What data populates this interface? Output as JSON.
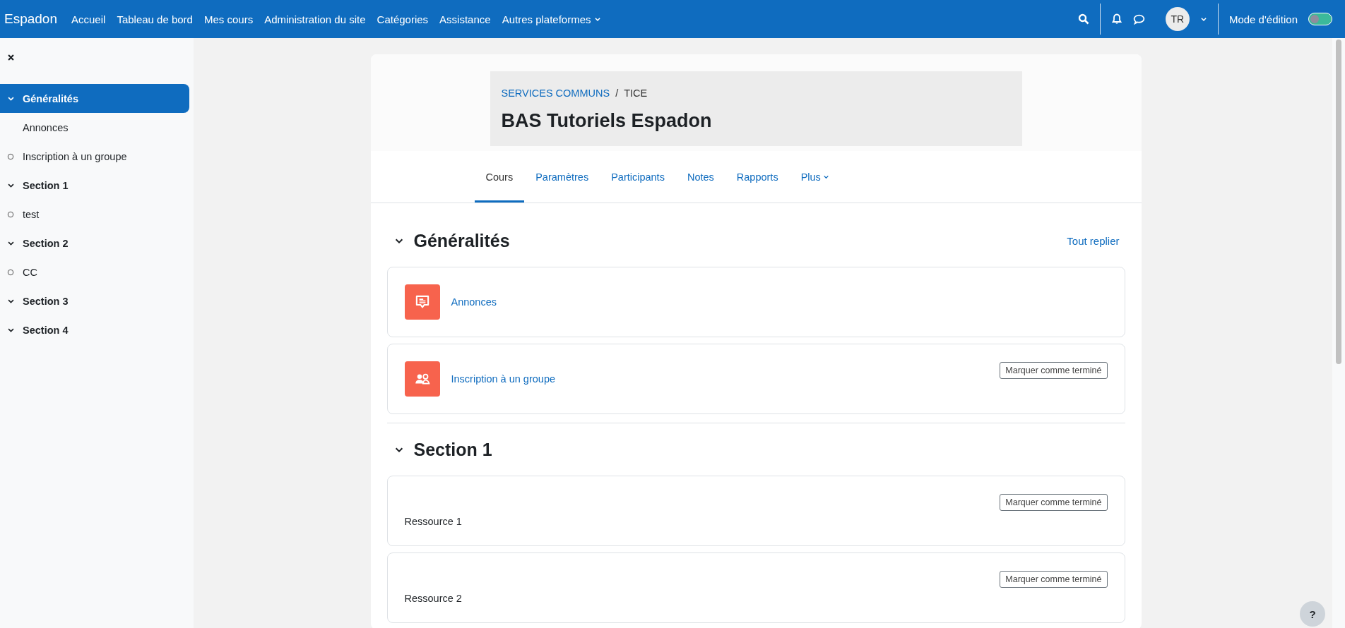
{
  "navbar": {
    "brand": "Espadon",
    "links": [
      {
        "label": "Accueil",
        "dropdown": false
      },
      {
        "label": "Tableau de bord",
        "dropdown": false
      },
      {
        "label": "Mes cours",
        "dropdown": false
      },
      {
        "label": "Administration du site",
        "dropdown": false
      },
      {
        "label": "Catégories",
        "dropdown": false
      },
      {
        "label": "Assistance",
        "dropdown": false
      },
      {
        "label": "Autres plateformes",
        "dropdown": true
      }
    ],
    "avatar": "TR",
    "edit_mode": {
      "label": "Mode d'édition",
      "on": false
    }
  },
  "sidebar": {
    "items": [
      {
        "label": "Généralités",
        "kind": "section",
        "selected": true,
        "expanded": true,
        "children": [
          {
            "label": "Annonces",
            "selected": false
          },
          {
            "label": "Inscription à un groupe",
            "selected": false,
            "completed": false
          }
        ]
      },
      {
        "label": "Section 1",
        "kind": "section",
        "selected": false,
        "expanded": true,
        "children": [
          {
            "label": "test",
            "selected": false,
            "completed": false
          }
        ]
      },
      {
        "label": "Section 2",
        "kind": "section",
        "selected": false,
        "expanded": true,
        "children": [
          {
            "label": "CC",
            "selected": false,
            "completed": false
          }
        ]
      },
      {
        "label": "Section 3",
        "kind": "section",
        "selected": false,
        "expanded": true
      },
      {
        "label": "Section 4",
        "kind": "section",
        "selected": false,
        "expanded": true
      }
    ]
  },
  "header": {
    "breadcrumb": [
      {
        "label": "SERVICES COMMUNS",
        "link": true
      },
      {
        "label": "TICE",
        "link": false
      }
    ],
    "breadcrumb_separator": "/",
    "title": "BAS Tutoriels Espadon"
  },
  "tabs": [
    {
      "label": "Cours",
      "selected": true,
      "dropdown": false
    },
    {
      "label": "Paramètres",
      "selected": false,
      "dropdown": false
    },
    {
      "label": "Participants",
      "selected": false,
      "dropdown": false
    },
    {
      "label": "Notes",
      "selected": false,
      "dropdown": false
    },
    {
      "label": "Rapports",
      "selected": false,
      "dropdown": false
    },
    {
      "label": "Plus",
      "selected": false,
      "dropdown": true
    }
  ],
  "sections": [
    {
      "title": "Généralités",
      "expanded": true,
      "action": "Tout replier",
      "activities": [
        {
          "kind": "forum",
          "name": "Annonces"
        },
        {
          "kind": "group",
          "name": "Inscription à un groupe",
          "button": "Marquer comme terminé"
        }
      ]
    },
    {
      "title": "Section 1",
      "expanded": true,
      "activities": [
        {
          "kind": "text",
          "name": "Ressource 1",
          "button": "Marquer comme terminé"
        },
        {
          "kind": "text",
          "name": "Ressource 2",
          "button": "Marquer comme terminé"
        }
      ]
    }
  ],
  "help": "?"
}
